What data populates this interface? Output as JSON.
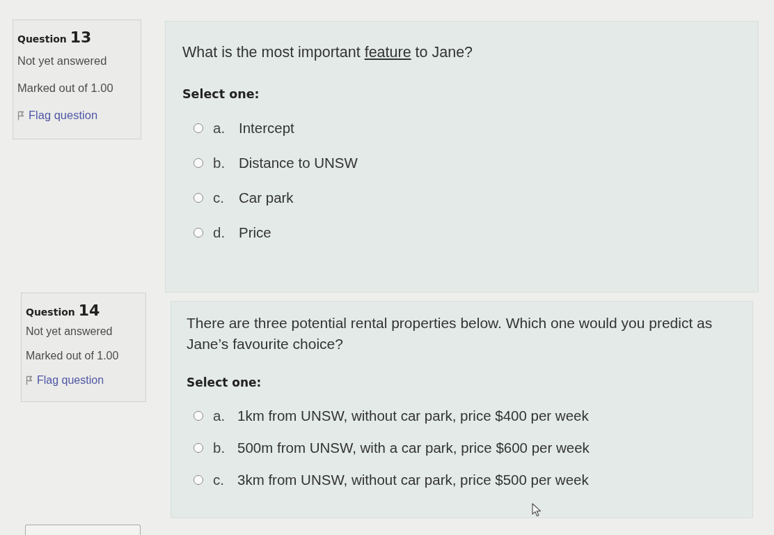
{
  "questions": [
    {
      "heading": "Question",
      "number": "13",
      "status": "Not yet answered",
      "marks": "Marked out of 1.00",
      "flag": {
        "label": "Flag question",
        "flagged": false
      },
      "text": [
        {
          "text": "What is the most important ",
          "underlined": false
        },
        {
          "text": "feature",
          "underlined": true
        },
        {
          "text": " to Jane?",
          "underlined": false
        }
      ],
      "prompt": "Select one:",
      "options": [
        {
          "letter": "a.",
          "text": "Intercept",
          "selected": false
        },
        {
          "letter": "b.",
          "text": "Distance to UNSW",
          "selected": false
        },
        {
          "letter": "c.",
          "text": "Car park",
          "selected": false
        },
        {
          "letter": "d.",
          "text": "Price",
          "selected": false
        }
      ]
    },
    {
      "heading": "Question",
      "number": "14",
      "status": "Not yet answered",
      "marks": "Marked out of 1.00",
      "flag": {
        "label": "Flag question",
        "flagged": false
      },
      "text": [
        {
          "text": "There are three potential rental properties below. Which one would you predict as Jane’s favourite choice?",
          "underlined": false
        }
      ],
      "prompt": "Select one:",
      "options": [
        {
          "letter": "a.",
          "text": "1km from UNSW, without car park, price $400 per week",
          "selected": false
        },
        {
          "letter": "b.",
          "text": "500m from UNSW, with a car park, price $600 per week",
          "selected": false
        },
        {
          "letter": "c.",
          "text": "3km from UNSW, without car park, price $500 per week",
          "selected": false
        }
      ]
    }
  ]
}
